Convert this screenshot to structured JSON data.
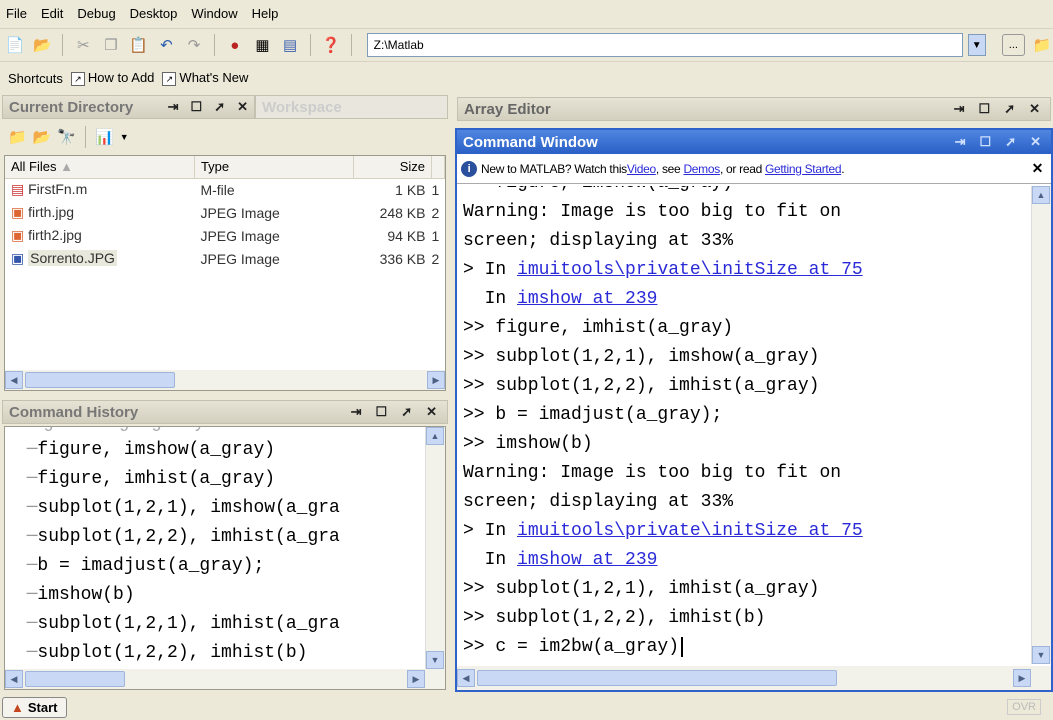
{
  "menu": [
    "File",
    "Edit",
    "Debug",
    "Desktop",
    "Window",
    "Help"
  ],
  "toolbar": {
    "path": "Z:\\Matlab",
    "browse_label": "...",
    "icons": [
      "new-file-icon",
      "open-icon",
      "cut-icon",
      "copy-icon",
      "paste-icon",
      "undo-icon",
      "redo-icon",
      "simulink-icon",
      "guide-icon",
      "profiler-icon",
      "help-icon"
    ]
  },
  "shortcuts": {
    "label": "Shortcuts",
    "items": [
      "How to Add",
      "What's New"
    ]
  },
  "current_directory": {
    "title": "Current Directory",
    "tab2": "Workspace",
    "columns": [
      "All Files",
      "Type",
      "Size"
    ],
    "files": [
      {
        "name": "FirstFn.m",
        "type": "M-file",
        "size": "1 KB",
        "extra": "1"
      },
      {
        "name": "firth.jpg",
        "type": "JPEG Image",
        "size": "248 KB",
        "extra": "2"
      },
      {
        "name": "firth2.jpg",
        "type": "JPEG Image",
        "size": "94 KB",
        "extra": "1"
      },
      {
        "name": "Sorrento.JPG",
        "type": "JPEG Image",
        "size": "336 KB",
        "extra": "2"
      }
    ]
  },
  "command_history": {
    "title": "Command History",
    "lines": [
      "figure, imshow(a_gray)",
      "figure, imhist(a_gray)",
      "subplot(1,2,1), imshow(a_gra",
      "subplot(1,2,2), imhist(a_gra",
      "b = imadjust(a_gray);",
      "imshow(b)",
      "subplot(1,2,1), imhist(a_gra",
      "subplot(1,2,2), imhist(b)"
    ]
  },
  "array_editor": {
    "title": "Array Editor"
  },
  "command_window": {
    "title": "Command Window",
    "banner": {
      "text1": "New to MATLAB? Watch this ",
      "link1": "Video",
      "text2": ", see ",
      "link2": "Demos",
      "text3": ", or read ",
      "link3": "Getting Started",
      "text4": "."
    },
    "lines": [
      {
        "t": ">> figure, imshow(a_gray)"
      },
      {
        "t": "Warning: Image is too big to fit on"
      },
      {
        "t": "screen; displaying at 33%"
      },
      {
        "p": "> In ",
        "l": "imuitools\\private\\initSize at 75"
      },
      {
        "p": "  In ",
        "l": "imshow at 239"
      },
      {
        "t": ">> figure, imhist(a_gray)"
      },
      {
        "t": ">> subplot(1,2,1), imshow(a_gray)"
      },
      {
        "t": ">> subplot(1,2,2), imhist(a_gray)"
      },
      {
        "t": ">> b = imadjust(a_gray);"
      },
      {
        "t": ">> imshow(b)"
      },
      {
        "t": "Warning: Image is too big to fit on"
      },
      {
        "t": "screen; displaying at 33%"
      },
      {
        "p": "> In ",
        "l": "imuitools\\private\\initSize at 75"
      },
      {
        "p": "  In ",
        "l": "imshow at 239"
      },
      {
        "t": ">> subplot(1,2,1), imhist(a_gray)"
      },
      {
        "t": ">> subplot(1,2,2), imhist(b)"
      },
      {
        "t": ">> c = im2bw(a_gray)"
      }
    ]
  },
  "status": {
    "start": "Start",
    "ovr": "OVR"
  }
}
